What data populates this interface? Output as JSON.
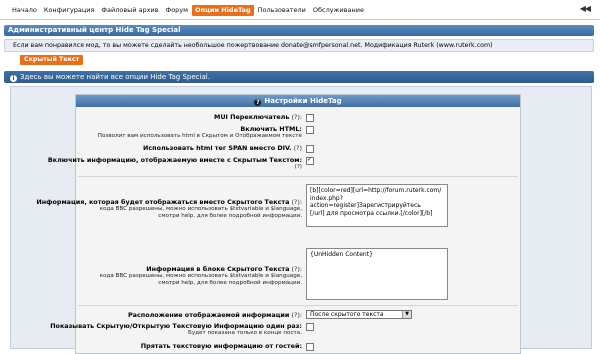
{
  "nav": {
    "items": [
      "Начало",
      "Конфигурация",
      "Файловый архив",
      "Форум",
      "Опции HideTag",
      "Пользователи",
      "Обслуживание"
    ],
    "active_index": 4,
    "collapse_glyph": "◀◀"
  },
  "admin_header": "Административный центр Hide Tag Special",
  "donate_text": "Если вам понравился мод, то вы можете сделайть необольшое пожертвование donate@smfpersonal.net. Модификация Ruterk (www.ruterk.com)",
  "tab_button": "Скрытый Текст",
  "info_bar": "Здесь вы можете найти все опции Hide Tag Special.",
  "settings": {
    "title": "Настройки HideTag",
    "mui_label": "MUI Переключатель",
    "html_label": "Включить HTML:",
    "html_sub": "Позволит вам использовать html в Скрытом и Отображаемом тексте",
    "span_label": "Использовать html тег SPAN вместо DIV.",
    "include_info_label": "Включить информацию, отображаемую вместе с Скрытым Текстом:",
    "q": "(?)",
    "display_info_label": "Информация, которая будет отображаться вместо Скрытого Текста",
    "display_info_sub1": "кода BBC разрешены, можно использовать $txtvariable и $language,",
    "display_info_sub2": "смотри help, для более подробной информации.",
    "display_info_value": "[b][color=red][url=http://forum.ruterk.com/\nindex.php?action=register]Зарегистрируйтесь\n[/url] для просмотра ссылки.[/color][/b]",
    "unhidden_label": "Информация в блоке Скрытого Текста",
    "unhidden_sub1": "кода BBC разрешены, можно использовать $txtvariable и $language,",
    "unhidden_sub2": "смотри help, для более подробной информации.",
    "unhidden_value": "{UnHidden Content}",
    "position_label": "Расположение отображаемой информации",
    "position_value": "После скрытого текста",
    "show_once_label": "Показывать Скрытую/Открытую Текстовую Информацию один раз:",
    "show_once_sub": "Будет показана только в конце поста.",
    "hide_guests_label": "Прятать текстовую информацию от гостей:"
  },
  "colors": {
    "accent": "#e8701b",
    "header_blue": "#3f6fa3",
    "panel_bg": "#e7ebf2"
  }
}
